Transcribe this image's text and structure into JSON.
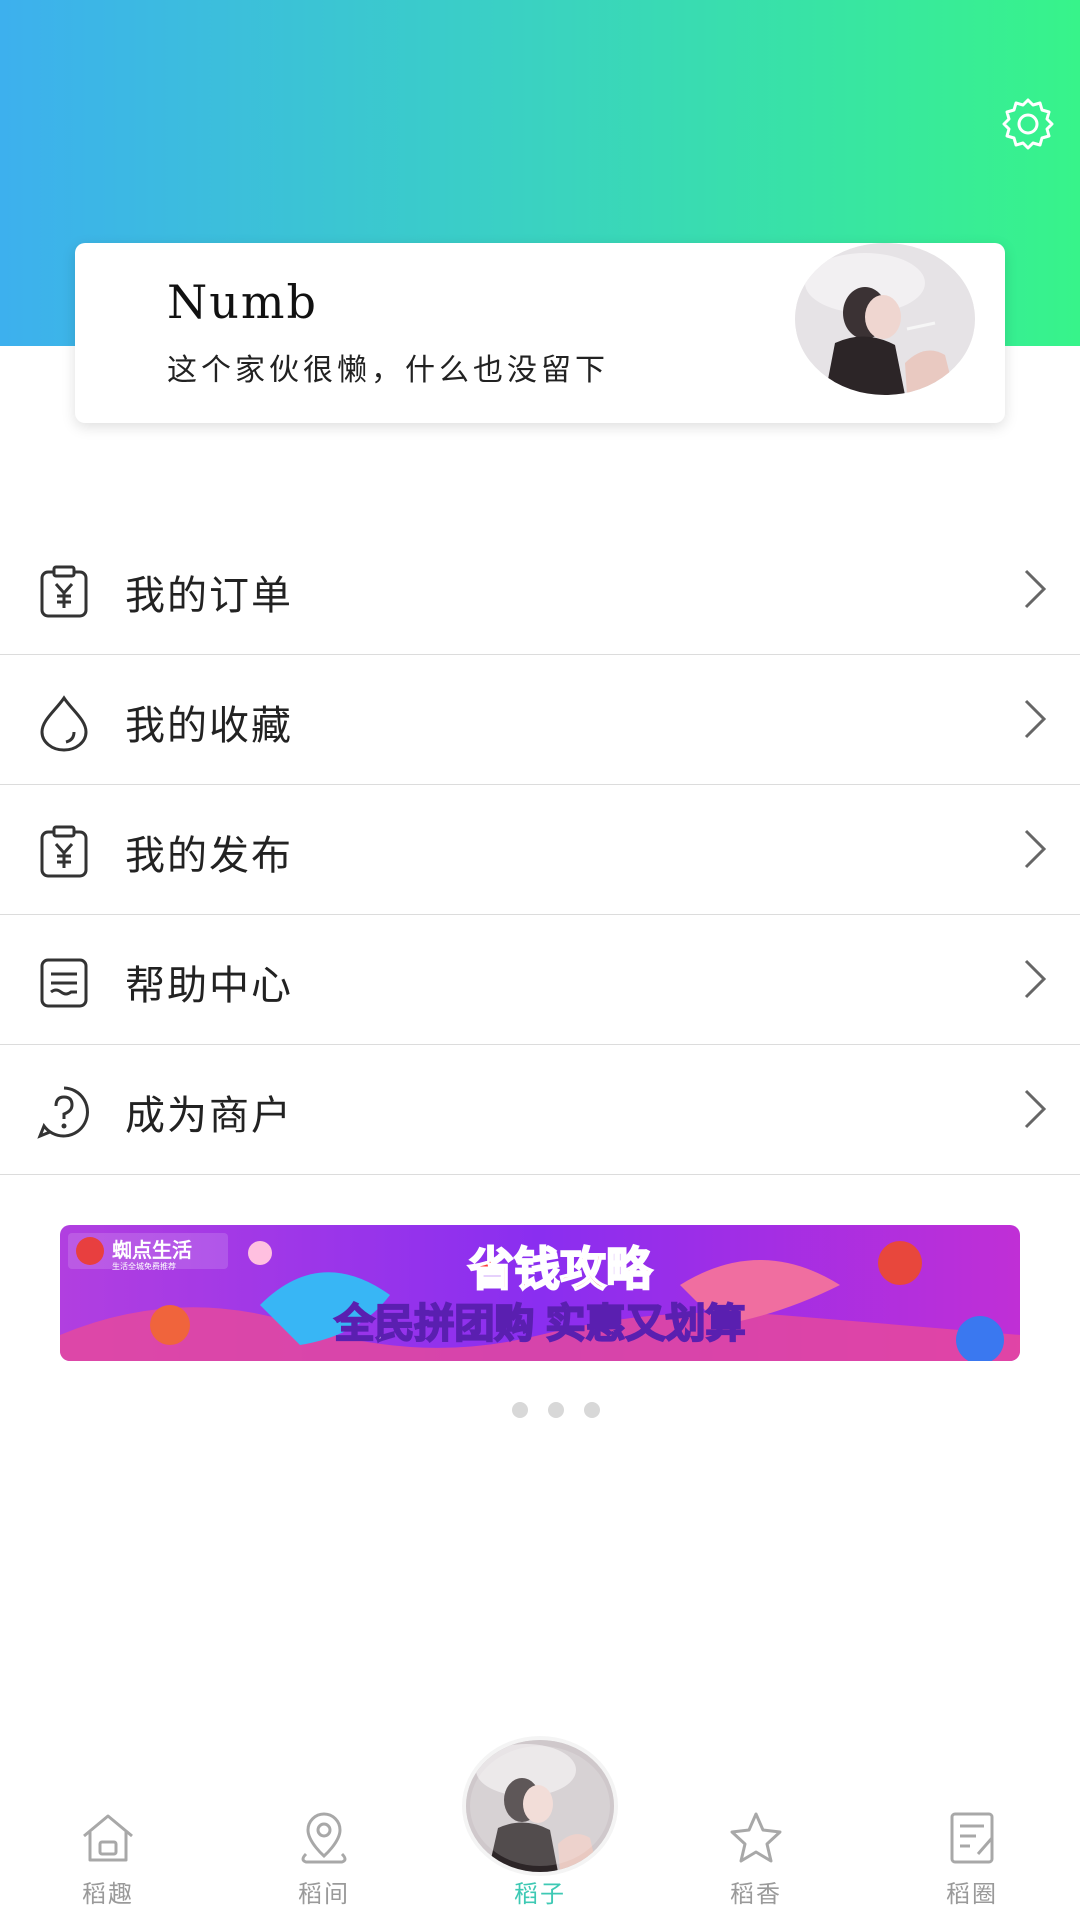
{
  "profile": {
    "name": "Numb",
    "bio": "这个家伙很懒，什么也没留下"
  },
  "header": {
    "settings_icon": "gear-icon"
  },
  "menu": {
    "items": [
      {
        "label": "我的订单",
        "icon": "order-yen-icon"
      },
      {
        "label": "我的收藏",
        "icon": "drop-icon"
      },
      {
        "label": "我的发布",
        "icon": "publish-yen-icon"
      },
      {
        "label": "帮助中心",
        "icon": "document-icon"
      },
      {
        "label": "成为商户",
        "icon": "question-icon"
      }
    ]
  },
  "banner": {
    "brand": "蜘点生活",
    "brand_sub": "生活全城免费推荐",
    "title": "省钱攻略",
    "subtitle": "全民拼团购 实惠又划算"
  },
  "pagination": {
    "count": 3
  },
  "tabbar": {
    "tabs": [
      {
        "label": "稻趣",
        "icon": "home-icon"
      },
      {
        "label": "稻间",
        "icon": "location-pin-icon"
      },
      {
        "label": "稻子",
        "icon": "avatar"
      },
      {
        "label": "稻香",
        "icon": "star-icon"
      },
      {
        "label": "稻圈",
        "icon": "edit-note-icon"
      }
    ],
    "active_color": "#3ec9b4"
  },
  "colors": {
    "gradient_start": "#3db0ee",
    "gradient_end": "#37f48a"
  }
}
